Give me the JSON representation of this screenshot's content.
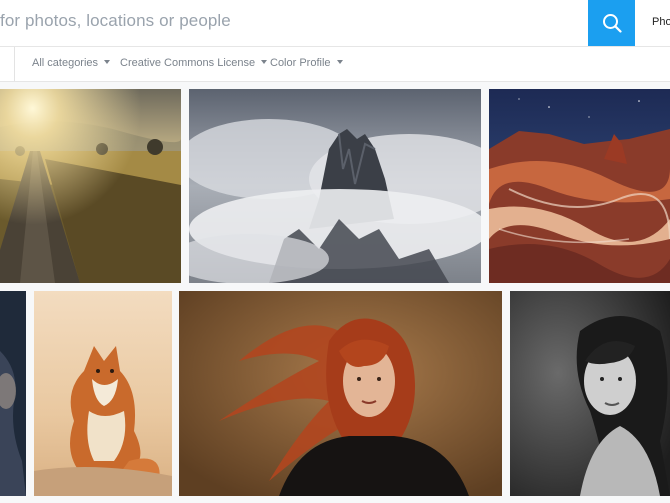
{
  "search": {
    "text": "for photos, locations or people"
  },
  "header": {
    "nav_label": "Pho"
  },
  "filters": [
    {
      "label": "All categories"
    },
    {
      "label": "Creative Commons License"
    },
    {
      "label": "Color Profile"
    }
  ],
  "photos": [
    {
      "subject": "country road at sunrise"
    },
    {
      "subject": "rock peaks in clouds"
    },
    {
      "subject": "red sandstone desert at night"
    },
    {
      "subject": "partial portrait"
    },
    {
      "subject": "red fox sitting in grass"
    },
    {
      "subject": "woman with flowing red hair"
    },
    {
      "subject": "black and white portrait"
    }
  ],
  "colors": {
    "accent": "#1b9ff0"
  }
}
